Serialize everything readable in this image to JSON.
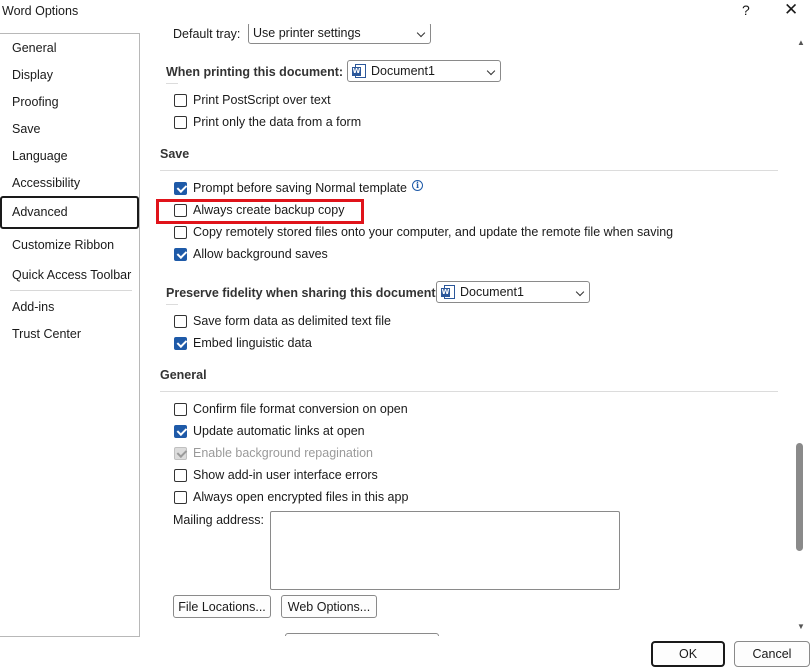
{
  "window": {
    "title": "Word Options",
    "help_glyph": "?",
    "close_glyph": "✕"
  },
  "nav": {
    "items": [
      {
        "label": "General"
      },
      {
        "label": "Display"
      },
      {
        "label": "Proofing"
      },
      {
        "label": "Save"
      },
      {
        "label": "Language"
      },
      {
        "label": "Accessibility"
      },
      {
        "label": "Advanced",
        "selected": true
      },
      {
        "label": "Customize Ribbon"
      },
      {
        "label": "Quick Access Toolbar"
      },
      {
        "label": "Add-ins"
      },
      {
        "label": "Trust Center"
      }
    ]
  },
  "print": {
    "default_tray_label": "Default tray:",
    "default_tray_value": "Use printer settings",
    "when_printing_label": "When printing this document:",
    "when_printing_doc": "Document1",
    "options": [
      {
        "label": "Print PostScript over text",
        "checked": false
      },
      {
        "label": "Print only the data from a form",
        "checked": false
      }
    ]
  },
  "save": {
    "heading": "Save",
    "options": [
      {
        "label": "Prompt before saving Normal template",
        "checked": true,
        "info_glyph": "i"
      },
      {
        "label": "Always create backup copy",
        "checked": false
      },
      {
        "label": "Copy remotely stored files onto your computer, and update the remote file when saving",
        "checked": false
      },
      {
        "label": "Allow background saves",
        "checked": true
      }
    ]
  },
  "fidelity": {
    "label": "Preserve fidelity when sharing this document:",
    "doc": "Document1",
    "options": [
      {
        "label": "Save form data as delimited text file",
        "checked": false
      },
      {
        "label": "Embed linguistic data",
        "checked": true
      }
    ]
  },
  "general": {
    "heading": "General",
    "options": [
      {
        "label": "Confirm file format conversion on open",
        "checked": false
      },
      {
        "label": "Update automatic links at open",
        "checked": true
      },
      {
        "label": "Enable background repagination",
        "checked": true,
        "disabled": true
      },
      {
        "label": "Show add-in user interface errors",
        "checked": false
      },
      {
        "label": "Always open encrypted files in this app",
        "checked": false
      }
    ],
    "mailing_address_label": "Mailing address:",
    "mailing_address_value": "",
    "file_locations_btn": "File Locations...",
    "web_options_btn": "Web Options..."
  },
  "footer": {
    "ok": "OK",
    "cancel": "Cancel"
  },
  "scrollbar": {
    "up_glyph": "▲",
    "down_glyph": "▼"
  },
  "colors": {
    "accent": "#1e5aa8",
    "highlight": "#e0131a",
    "word_blue": "#2b579a"
  }
}
